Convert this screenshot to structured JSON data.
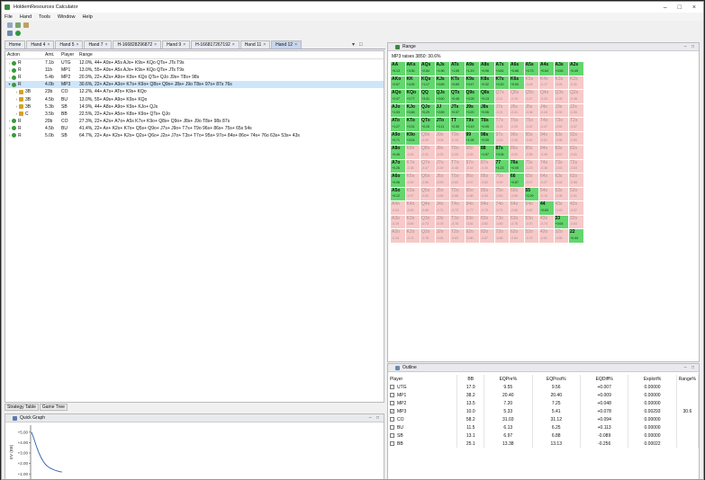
{
  "window": {
    "title": "HoldemResources Calculator"
  },
  "menu": [
    "File",
    "Hand",
    "Tools",
    "Window",
    "Help"
  ],
  "hand_tabs": [
    {
      "label": "Home",
      "selected": false
    },
    {
      "label": "Hand 4",
      "selected": false
    },
    {
      "label": "Hand 5",
      "selected": false
    },
    {
      "label": "Hand 7",
      "selected": false
    },
    {
      "label": "H-166828296872",
      "selected": false
    },
    {
      "label": "Hand 9",
      "selected": false
    },
    {
      "label": "H-166817267192",
      "selected": false
    },
    {
      "label": "Hand 11",
      "selected": false
    },
    {
      "label": "Hand 12",
      "selected": true
    }
  ],
  "action_table": {
    "headers": {
      "action": "Action",
      "amt": "Amt.",
      "player": "Player",
      "range": "Range"
    },
    "rows": [
      {
        "action": "R",
        "amt": "7.1b",
        "player": "UTG",
        "range": "12.0%, 44+ A9s+ A5s AJo+ K9s+ KQo QTs+ JTs T9s",
        "icon": "g",
        "indent": 0,
        "selected": false
      },
      {
        "action": "R",
        "amt": "11b",
        "player": "MP1",
        "range": "13.0%, 55+ A9s+ A5s AJo+ K9s+ KQo QTs+ JTs T9s",
        "icon": "g",
        "indent": 0,
        "selected": false
      },
      {
        "action": "R",
        "amt": "5.4b",
        "player": "MP2",
        "range": "20.9%, 22+ A2s+ A9o+ K9s+ KQo QTs+ QJo J9s+ T8s+ 98s",
        "icon": "g",
        "indent": 0,
        "selected": false
      },
      {
        "action": "R",
        "amt": "4.0b",
        "player": "MP3",
        "range": "30.6%, 22+ A2s+ A3o+ K7s+ K9o+ Q8s+ Q9o+ J8s+ J9o T8s+ 97s+ 87s 76s",
        "icon": "g",
        "indent": 0,
        "selected": true
      },
      {
        "action": "3B",
        "amt": "23b",
        "player": "CO",
        "range": "12.2%, 44+ A7s+ ATo+ K9s+ KQo",
        "icon": "y",
        "indent": 1,
        "selected": false
      },
      {
        "action": "3B",
        "amt": "4.5b",
        "player": "BU",
        "range": "13.0%, 55+ A9s+ A9o+ K9s+ KQo",
        "icon": "y",
        "indent": 1,
        "selected": false
      },
      {
        "action": "3B",
        "amt": "5.3b",
        "player": "SB",
        "range": "14.9%, 44+ A8s+ A9o+ K9s+ KJo+ QJs",
        "icon": "y",
        "indent": 1,
        "selected": false
      },
      {
        "action": "C",
        "amt": "3.5b",
        "player": "BB",
        "range": "22.5%, 22+ A2s+ A5o+ K8s+ K9o+ QTs+ QJo",
        "icon": "y",
        "indent": 1,
        "selected": false
      },
      {
        "action": "R",
        "amt": "20b",
        "player": "CO",
        "range": "27.3%, 22+ A2s+ A7o+ A5s K7s+ K9o+ Q8s+ Q9o+ J8s+ J9o T8s+ 98s 87s",
        "icon": "g",
        "indent": 0,
        "selected": false
      },
      {
        "action": "R",
        "amt": "4.5b",
        "player": "BU",
        "range": "41.4%, 22+ Ax+ K2s+ K7o+ Q5s+ Q9o+ J7s+ J9o+ T7s+ T9o 96s+ 86s+ 75s+ 65s 54s",
        "icon": "g",
        "indent": 0,
        "selected": false
      },
      {
        "action": "R",
        "amt": "5.0b",
        "player": "SB",
        "range": "64.7%, 22+ Ax+ K2s+ K2o+ Q2s+ Q6o+ J2s+ J7o+ T3s+ T7o+ 95s+ 97o+ 84s+ 86o+ 74s+ 76o 63s+ 53s+ 43s",
        "icon": "g",
        "indent": 0,
        "selected": false
      }
    ]
  },
  "bottom_tabs": [
    "Strategy Table",
    "Game Tree"
  ],
  "quick_graph": {
    "title": "Quick Graph",
    "y_ticks": [
      "+5.00",
      "+4.00",
      "+3.00",
      "+2.00",
      "+1.00"
    ],
    "y_label": "EV (BB)",
    "values": [
      5.0,
      4.4,
      3.7,
      3.1,
      2.6,
      2.2,
      1.9,
      1.7,
      1.55,
      1.45,
      1.35,
      1.28,
      1.22,
      1.18
    ]
  },
  "range_panel": {
    "title": "Range",
    "subtitle": "MP3 raises 3850: 30.6%",
    "grid": [
      [
        "AA",
        "+5.13",
        "pos"
      ],
      [
        "AKs",
        "+3.35",
        "pos"
      ],
      [
        "AQs",
        "+2.84",
        "pos"
      ],
      [
        "AJs",
        "+1.96",
        "pos"
      ],
      [
        "ATs",
        "+1.55",
        "pos"
      ],
      [
        "A9s",
        "+1.19",
        "pos"
      ],
      [
        "A8s",
        "+0.96",
        "pos"
      ],
      [
        "A7s",
        "+0.81",
        "pos"
      ],
      [
        "A6s",
        "+0.68",
        "pos"
      ],
      [
        "A5s",
        "+0.73",
        "pos"
      ],
      [
        "A4s",
        "+0.64",
        "pos"
      ],
      [
        "A3s",
        "+0.55",
        "pos"
      ],
      [
        "A2s",
        "+0.45",
        "pos"
      ],
      [
        "AKo",
        "+2.67",
        "pos"
      ],
      [
        "KK",
        "+4.26",
        "pos"
      ],
      [
        "KQs",
        "+1.17",
        "pos"
      ],
      [
        "KJs",
        "+0.89",
        "pos"
      ],
      [
        "KTs",
        "+0.69",
        "pos"
      ],
      [
        "K9s",
        "+0.47",
        "pos"
      ],
      [
        "K8s",
        "+0.32",
        "pos"
      ],
      [
        "K7s",
        "+0.15",
        "pos"
      ],
      [
        "K6s",
        "+0.00",
        "pos"
      ],
      [
        "K5s",
        "-0.08",
        "neg"
      ],
      [
        "K4s",
        "-0.17",
        "neg"
      ],
      [
        "K3s",
        "-0.24",
        "neg"
      ],
      [
        "K2s",
        "-0.31",
        "neg"
      ],
      [
        "AQo",
        "+2.07",
        "pos"
      ],
      [
        "KQo",
        "+0.77",
        "pos"
      ],
      [
        "QQ",
        "+3.41",
        "pos"
      ],
      [
        "QJs",
        "+0.60",
        "pos"
      ],
      [
        "QTs",
        "+0.45",
        "pos"
      ],
      [
        "Q9s",
        "+0.28",
        "pos"
      ],
      [
        "Q8s",
        "+0.13",
        "pos"
      ],
      [
        "Q7s",
        "-0.11",
        "neg"
      ],
      [
        "Q6s",
        "-0.19",
        "neg"
      ],
      [
        "Q5s",
        "-0.27",
        "neg"
      ],
      [
        "Q4s",
        "-0.33",
        "neg"
      ],
      [
        "Q3s",
        "-0.39",
        "neg"
      ],
      [
        "Q2s",
        "-0.46",
        "neg"
      ],
      [
        "AJo",
        "+1.53",
        "pos"
      ],
      [
        "KJo",
        "+0.48",
        "pos"
      ],
      [
        "QJo",
        "+0.29",
        "pos"
      ],
      [
        "JJ",
        "+2.89",
        "pos"
      ],
      [
        "JTs",
        "+0.37",
        "pos"
      ],
      [
        "J9s",
        "+0.20",
        "pos"
      ],
      [
        "J8s",
        "+0.06",
        "pos"
      ],
      [
        "J7s",
        "-0.21",
        "neg"
      ],
      [
        "J6s",
        "-0.31",
        "neg"
      ],
      [
        "J5s",
        "-0.38",
        "neg"
      ],
      [
        "J4s",
        "-0.44",
        "neg"
      ],
      [
        "J3s",
        "-0.50",
        "neg"
      ],
      [
        "J2s",
        "-0.55",
        "neg"
      ],
      [
        "ATo",
        "+1.27",
        "pos"
      ],
      [
        "KTo",
        "+0.31",
        "pos"
      ],
      [
        "QTo",
        "+0.15",
        "pos"
      ],
      [
        "JTo",
        "+0.11",
        "pos"
      ],
      [
        "TT",
        "+2.39",
        "pos"
      ],
      [
        "T9s",
        "+0.19",
        "pos"
      ],
      [
        "T8s",
        "+0.05",
        "pos"
      ],
      [
        "T7s",
        "-0.24",
        "neg"
      ],
      [
        "T6s",
        "-0.33",
        "neg"
      ],
      [
        "T5s",
        "-0.42",
        "neg"
      ],
      [
        "T4s",
        "-0.47",
        "neg"
      ],
      [
        "T3s",
        "-0.52",
        "neg"
      ],
      [
        "T2s",
        "-0.57",
        "neg"
      ],
      [
        "A9o",
        "+0.71",
        "pos"
      ],
      [
        "K9o",
        "+0.04",
        "pos"
      ],
      [
        "Q9o",
        "-0.05",
        "neg"
      ],
      [
        "J9o",
        "-0.08",
        "neg"
      ],
      [
        "T9o",
        "-0.13",
        "neg"
      ],
      [
        "99",
        "+1.95",
        "pos"
      ],
      [
        "98s",
        "+0.05",
        "pos"
      ],
      [
        "97s",
        "-0.15",
        "neg"
      ],
      [
        "96s",
        "-0.28",
        "neg"
      ],
      [
        "95s",
        "-0.40",
        "neg"
      ],
      [
        "94s",
        "-0.51",
        "neg"
      ],
      [
        "93s",
        "-0.56",
        "neg"
      ],
      [
        "92s",
        "-0.60",
        "neg"
      ],
      [
        "A8o",
        "+0.46",
        "pos"
      ],
      [
        "K8o",
        "-0.24",
        "neg"
      ],
      [
        "Q8o",
        "-0.31",
        "neg"
      ],
      [
        "J8o",
        "-0.32",
        "neg"
      ],
      [
        "T8o",
        "-0.33",
        "neg"
      ],
      [
        "98o",
        "-0.28",
        "neg"
      ],
      [
        "88",
        "+1.57",
        "pos"
      ],
      [
        "87s",
        "+0.06",
        "pos"
      ],
      [
        "86s",
        "-0.20",
        "neg"
      ],
      [
        "85s",
        "-0.35",
        "neg"
      ],
      [
        "84s",
        "-0.49",
        "neg"
      ],
      [
        "83s",
        "-0.57",
        "neg"
      ],
      [
        "82s",
        "-0.61",
        "neg"
      ],
      [
        "A7o",
        "+0.26",
        "pos"
      ],
      [
        "K7o",
        "-0.38",
        "neg"
      ],
      [
        "Q7o",
        "-0.47",
        "neg"
      ],
      [
        "J7o",
        "-0.49",
        "neg"
      ],
      [
        "T7o",
        "-0.48",
        "neg"
      ],
      [
        "97o",
        "-0.44",
        "neg"
      ],
      [
        "87o",
        "-0.40",
        "neg"
      ],
      [
        "77",
        "+1.23",
        "pos"
      ],
      [
        "76s",
        "+0.05",
        "pos"
      ],
      [
        "75s",
        "-0.23",
        "neg"
      ],
      [
        "74s",
        "-0.38",
        "neg"
      ],
      [
        "73s",
        "-0.53",
        "neg"
      ],
      [
        "72s",
        "-0.63",
        "neg"
      ],
      [
        "A6o",
        "+0.06",
        "pos"
      ],
      [
        "K6o",
        "-0.50",
        "neg"
      ],
      [
        "Q6o",
        "-0.56",
        "neg"
      ],
      [
        "J6o",
        "-0.59",
        "neg"
      ],
      [
        "T6o",
        "-0.60",
        "neg"
      ],
      [
        "96o",
        "-0.57",
        "neg"
      ],
      [
        "86o",
        "-0.52",
        "neg"
      ],
      [
        "76o",
        "-0.49",
        "neg"
      ],
      [
        "66",
        "+0.87",
        "pos"
      ],
      [
        "65s",
        "-0.07",
        "neg"
      ],
      [
        "64s",
        "-0.27",
        "neg"
      ],
      [
        "63s",
        "-0.44",
        "neg"
      ],
      [
        "62s",
        "-0.58",
        "neg"
      ],
      [
        "A5o",
        "+0.12",
        "pos"
      ],
      [
        "K5o",
        "-0.57",
        "neg"
      ],
      [
        "Q5o",
        "-0.63",
        "neg"
      ],
      [
        "J5o",
        "-0.66",
        "neg"
      ],
      [
        "T5o",
        "-0.68",
        "neg"
      ],
      [
        "95o",
        "-0.68",
        "neg"
      ],
      [
        "85o",
        "-0.64",
        "neg"
      ],
      [
        "75o",
        "-0.60",
        "neg"
      ],
      [
        "65o",
        "-0.56",
        "neg"
      ],
      [
        "55",
        "+1.09",
        "pos"
      ],
      [
        "54s",
        "-0.19",
        "neg"
      ],
      [
        "53s",
        "-0.35",
        "neg"
      ],
      [
        "52s",
        "-0.51",
        "neg"
      ],
      [
        "A4o",
        "-0.04",
        "neg"
      ],
      [
        "K4o",
        "-0.63",
        "neg"
      ],
      [
        "Q4o",
        "-0.68",
        "neg"
      ],
      [
        "J4o",
        "-0.71",
        "neg"
      ],
      [
        "T4o",
        "-0.73",
        "neg"
      ],
      [
        "94o",
        "-0.77",
        "neg"
      ],
      [
        "84o",
        "-0.75",
        "neg"
      ],
      [
        "74o",
        "-0.71",
        "neg"
      ],
      [
        "64o",
        "-0.66",
        "neg"
      ],
      [
        "54o",
        "-0.62",
        "neg"
      ],
      [
        "44",
        "+0.83",
        "pos"
      ],
      [
        "43s",
        "-0.43",
        "neg"
      ],
      [
        "42s",
        "-0.57",
        "neg"
      ],
      [
        "A3o",
        "-0.19",
        "neg"
      ],
      [
        "K3o",
        "-0.69",
        "neg"
      ],
      [
        "Q3o",
        "-0.73",
        "neg"
      ],
      [
        "J3o",
        "-0.76",
        "neg"
      ],
      [
        "T3o",
        "-0.78",
        "neg"
      ],
      [
        "93o",
        "-0.81",
        "neg"
      ],
      [
        "83o",
        "-0.82",
        "neg"
      ],
      [
        "73o",
        "-0.80",
        "neg"
      ],
      [
        "63o",
        "-0.75",
        "neg"
      ],
      [
        "53o",
        "-0.70",
        "neg"
      ],
      [
        "43o",
        "-0.74",
        "neg"
      ],
      [
        "33",
        "+0.64",
        "pos"
      ],
      [
        "32s",
        "-0.63",
        "neg"
      ],
      [
        "A2o",
        "-0.14",
        "neg"
      ],
      [
        "K2o",
        "-0.74",
        "neg"
      ],
      [
        "Q2o",
        "-0.78",
        "neg"
      ],
      [
        "J2o",
        "-0.81",
        "neg"
      ],
      [
        "T2o",
        "-0.83",
        "neg"
      ],
      [
        "92o",
        "-0.86",
        "neg"
      ],
      [
        "82o",
        "-0.87",
        "neg"
      ],
      [
        "72o",
        "-0.88",
        "neg"
      ],
      [
        "62o",
        "-0.84",
        "neg"
      ],
      [
        "52o",
        "-0.79",
        "neg"
      ],
      [
        "42o",
        "-0.81",
        "neg"
      ],
      [
        "32o",
        "-0.85",
        "neg"
      ],
      [
        "22",
        "+0.44",
        "pos"
      ]
    ]
  },
  "outline": {
    "title": "Outline",
    "headers": [
      "Player",
      "BB",
      "EQPre%",
      "EQPost%",
      "EQDiff%",
      "Exploit%",
      "Range%"
    ],
    "rows": [
      {
        "player": "UTG",
        "bb": "17.9",
        "eqpre": "9.55",
        "eqpost": "9.56",
        "eqdiff": "+0.007",
        "exploit": "0.00000",
        "range": "",
        "checked": false
      },
      {
        "player": "MP1",
        "bb": "38.2",
        "eqpre": "20.40",
        "eqpost": "20.40",
        "eqdiff": "+0.009",
        "exploit": "0.00000",
        "range": "",
        "checked": false
      },
      {
        "player": "MP2",
        "bb": "13.5",
        "eqpre": "7.20",
        "eqpost": "7.25",
        "eqdiff": "+0.048",
        "exploit": "0.00000",
        "range": "",
        "checked": false
      },
      {
        "player": "MP3",
        "bb": "10.0",
        "eqpre": "5.33",
        "eqpost": "5.41",
        "eqdiff": "+0.078",
        "exploit": "0.00293",
        "range": "30.6",
        "checked": true
      },
      {
        "player": "CO",
        "bb": "58.2",
        "eqpre": "31.03",
        "eqpost": "31.12",
        "eqdiff": "+0.094",
        "exploit": "0.00000",
        "range": "",
        "checked": false
      },
      {
        "player": "BU",
        "bb": "11.5",
        "eqpre": "6.13",
        "eqpost": "6.25",
        "eqdiff": "+0.113",
        "exploit": "0.00000",
        "range": "",
        "checked": false
      },
      {
        "player": "SB",
        "bb": "13.1",
        "eqpre": "6.97",
        "eqpost": "6.88",
        "eqdiff": "-0.089",
        "exploit": "0.00000",
        "range": "",
        "checked": false
      },
      {
        "player": "BB",
        "bb": "25.1",
        "eqpre": "13.38",
        "eqpost": "13.13",
        "eqdiff": "-0.256",
        "exploit": "0.00022",
        "range": "",
        "checked": false
      }
    ]
  },
  "colors": {
    "positive_cell": "#64d66e",
    "negative_cell": "#f7c9c9",
    "selected_row": "#cde6fa"
  }
}
